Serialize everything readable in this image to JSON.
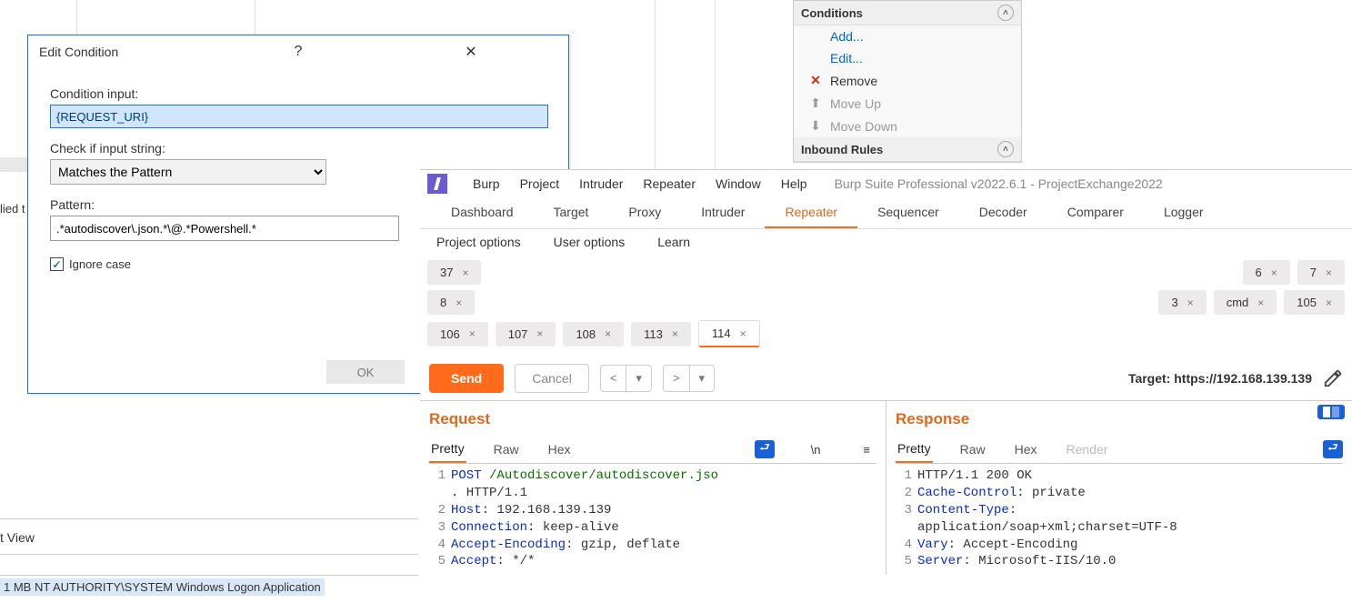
{
  "background": {
    "lied_text": "lied t",
    "t_view": "t View",
    "row1": "1 MB   NT AUTHORITY\\SYSTEM   Windows Logon Application"
  },
  "dialog": {
    "title": "Edit Condition",
    "label_input": "Condition input:",
    "input_value": "{REQUEST_URI}",
    "label_check": "Check if input string:",
    "check_value": "Matches the Pattern",
    "label_pattern": "Pattern:",
    "pattern_value": ".*autodiscover\\.json.*\\@.*Powershell.*",
    "ignore_case": "Ignore case",
    "ok": "OK"
  },
  "conditions_panel": {
    "header": "Conditions",
    "add": "Add...",
    "edit": "Edit...",
    "remove": "Remove",
    "moveup": "Move Up",
    "movedown": "Move Down",
    "inbound": "Inbound Rules"
  },
  "burp": {
    "menu": [
      "Burp",
      "Project",
      "Intruder",
      "Repeater",
      "Window",
      "Help"
    ],
    "title": "Burp Suite Professional v2022.6.1 - ProjectExchange2022",
    "tabs": [
      "Dashboard",
      "Target",
      "Proxy",
      "Intruder",
      "Repeater",
      "Sequencer",
      "Decoder",
      "Comparer",
      "Logger"
    ],
    "subtabs": [
      "Project options",
      "User options",
      "Learn"
    ],
    "rep_row1": [
      "37",
      "6",
      "7"
    ],
    "rep_row2": [
      "8",
      "3",
      "cmd",
      "105"
    ],
    "rep_row3": [
      "106",
      "107",
      "108",
      "113",
      "114"
    ],
    "send": "Send",
    "cancel": "Cancel",
    "target": "Target: https://192.168.139.139",
    "request_h": "Request",
    "response_h": "Response",
    "pane_tabs": [
      "Pretty",
      "Raw",
      "Hex"
    ],
    "render_tab": "Render",
    "newline_ico": "\\n",
    "request_lines": [
      {
        "n": "1",
        "pre": "POST ",
        "url": "/Autodiscover/autodiscover.jso",
        "tail": ""
      },
      {
        "n": "",
        "pre": "",
        "url": "",
        "tail": "              . HTTP/1.1"
      },
      {
        "n": "2",
        "hdr": "Host",
        "val": ": 192.168.139.139"
      },
      {
        "n": "3",
        "hdr": "Connection",
        "val": ": keep-alive"
      },
      {
        "n": "4",
        "hdr": "Accept-Encoding",
        "val": ": gzip, deflate"
      },
      {
        "n": "5",
        "hdr": "Accept",
        "val": ": */*"
      }
    ],
    "response_lines": [
      {
        "n": "1",
        "hdr": "",
        "val": "HTTP/1.1 200 OK"
      },
      {
        "n": "2",
        "hdr": "Cache-Control",
        "val": ": private"
      },
      {
        "n": "3",
        "hdr": "Content-Type",
        "val": ": "
      },
      {
        "n": "",
        "hdr": "",
        "val": "application/soap+xml;charset=UTF-8"
      },
      {
        "n": "4",
        "hdr": "Vary",
        "val": ": Accept-Encoding"
      },
      {
        "n": "5",
        "hdr": "Server",
        "val": ": Microsoft-IIS/10.0"
      }
    ]
  }
}
